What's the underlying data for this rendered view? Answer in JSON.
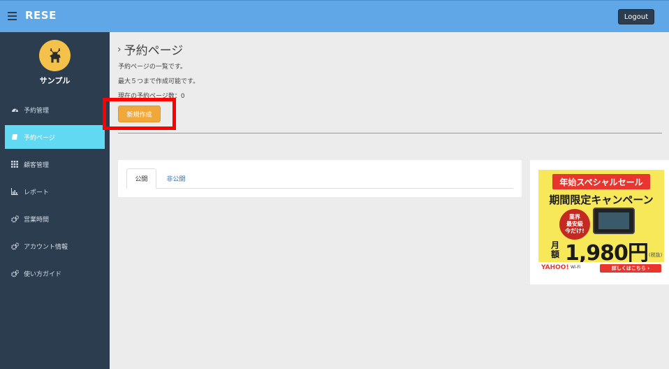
{
  "header": {
    "brand": "RESE",
    "logout_label": "Logout"
  },
  "sidebar": {
    "user_name": "サンプル",
    "items": [
      {
        "label": "予約管理",
        "icon": "dashboard-icon"
      },
      {
        "label": "予約ページ",
        "icon": "book-icon",
        "active": true
      },
      {
        "label": "顧客管理",
        "icon": "grid-icon"
      },
      {
        "label": "レポート",
        "icon": "chart-icon"
      },
      {
        "label": "営業時間",
        "icon": "gears-icon"
      },
      {
        "label": "アカウント情報",
        "icon": "gears-icon"
      },
      {
        "label": "使い方ガイド",
        "icon": "gears-icon"
      }
    ]
  },
  "main": {
    "title": "予約ページ",
    "desc1": "予約ページの一覧です。",
    "desc2": "最大５つまで作成可能です。",
    "count_text": "現在の予約ページ数：0",
    "new_button": "新規作成",
    "tabs": [
      {
        "label": "公開",
        "active": true
      },
      {
        "label": "非公開",
        "active": false
      }
    ]
  },
  "ad": {
    "ribbon": "年始スペシャルセール",
    "headline": "期間限定キャンペーン",
    "badge": [
      "業界",
      "最安級",
      "今だけ!"
    ],
    "price_label": "月額",
    "price": "1,980円",
    "tax": "(税抜)",
    "brand": "YAHOO!",
    "wifi": "Wi-Fi",
    "cta": "詳しくはこちら ›"
  },
  "colors": {
    "topbar": "#5fa7e6",
    "sidebar": "#2c3d4f",
    "active_nav": "#62d9f2",
    "new_button": "#f0a83c",
    "highlight": "#ff0000"
  }
}
